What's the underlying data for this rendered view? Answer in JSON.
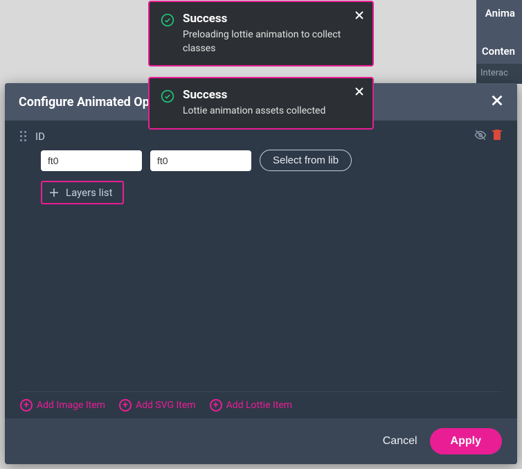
{
  "rightSidebar": {
    "label1": "Anima",
    "label2": "Conten",
    "label3": "Interac"
  },
  "toasts": [
    {
      "title": "Success",
      "message": "Preloading lottie animation to collect classes"
    },
    {
      "title": "Success",
      "message": "Lottie animation assets collected"
    }
  ],
  "modal": {
    "title": "Configure Animated Op",
    "idLabel": "ID",
    "inputs": {
      "value1": "ft0",
      "value2": "ft0"
    },
    "selectFromLib": "Select from lib",
    "layersList": "Layers list",
    "addLinks": {
      "image": "Add Image Item",
      "svg": "Add SVG Item",
      "lottie": "Add Lottie Item"
    },
    "footer": {
      "cancel": "Cancel",
      "apply": "Apply"
    }
  }
}
